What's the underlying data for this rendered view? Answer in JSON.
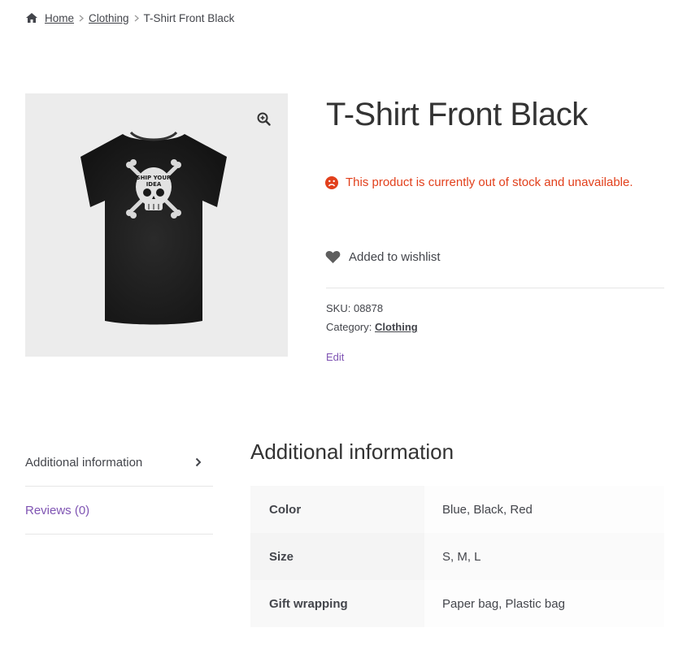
{
  "breadcrumb": {
    "home": "Home",
    "category": "Clothing",
    "current": "T-Shirt Front Black"
  },
  "product": {
    "title": "T-Shirt Front Black",
    "stock_message": "This product is currently out of stock and unavailable.",
    "wishlist_label": "Added to wishlist",
    "sku_label": "SKU:",
    "sku_value": "08878",
    "category_label": "Category:",
    "category_value": "Clothing",
    "edit_label": "Edit",
    "image_alt": "T-Shirt Front Black"
  },
  "tabs": [
    {
      "label": "Additional information",
      "active": true
    },
    {
      "label": "Reviews (0)",
      "active": false
    }
  ],
  "additional_info": {
    "title": "Additional information",
    "rows": [
      {
        "name": "Color",
        "value": "Blue, Black, Red"
      },
      {
        "name": "Size",
        "value": "S, M, L"
      },
      {
        "name": "Gift wrapping",
        "value": "Paper bag, Plastic bag"
      }
    ]
  },
  "colors": {
    "accent": "#7f54b3",
    "error": "#e2401c",
    "text": "#43454b",
    "image_bg": "#ececec"
  },
  "icons": {
    "home": "home-icon",
    "breadcrumb_separator": "chevron-right-icon",
    "zoom": "zoom-in-icon",
    "stock": "sad-face-icon",
    "wishlist": "heart-icon",
    "tab_arrow": "chevron-right-icon"
  }
}
